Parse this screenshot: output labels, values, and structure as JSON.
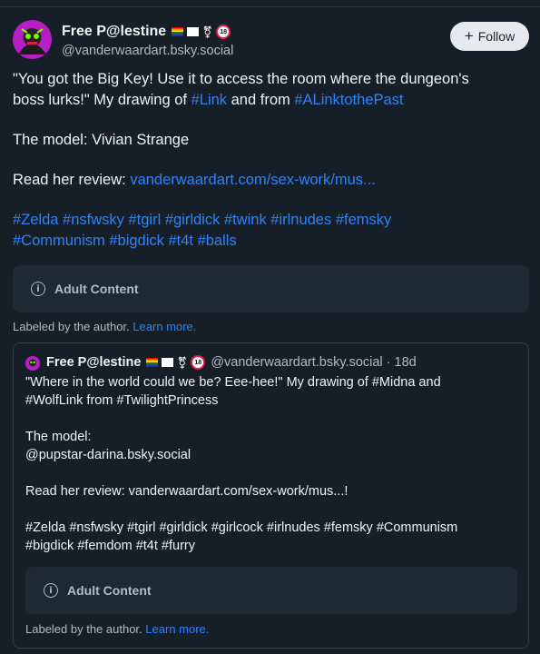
{
  "post": {
    "author_name": "Free P@lestine",
    "handle": "@vanderwaardart.bsky.social",
    "badge_text": "18",
    "follow_label": "Follow",
    "text": {
      "line1": "\"You got the Big Key! Use it to access the room where the dungeon's",
      "line2_prefix": "boss lurks!\" My drawing of ",
      "tag_link": "#Link",
      "line2_mid": " and from ",
      "tag_alttp": "#ALinktothePast",
      "model_line": "The model: Vivian Strange",
      "review_prefix": "Read her review: ",
      "review_link": "vanderwaardart.com/sex-work/mus...",
      "tags_line1": "#Zelda #nsfwsky #tgirl #girldick #twink #irlnudes #femsky",
      "tags_line2": "#Communism #bigdick #t4t #balls"
    },
    "content_warning": "Adult Content",
    "labeled_prefix": "Labeled by the author.",
    "learn_more": "Learn more."
  },
  "quote": {
    "author_name": "Free P@lestine",
    "handle": "@vanderwaardart.bsky.social · 18d",
    "line1": "\"Where in the world could we be? Eee-hee!\" My drawing of #Midna and",
    "line2": "#WolfLink from #TwilightPrincess",
    "model_label": "The model:",
    "model_handle": "@pupstar-darina.bsky.social",
    "review": "Read her review: vanderwaardart.com/sex-work/mus...!",
    "tags_line1": "#Zelda #nsfwsky #tgirl #girldick #girlcock #irlnudes #femsky #Communism",
    "tags_line2": "#bigdick #femdom #t4t #furry",
    "content_warning": "Adult Content",
    "labeled_prefix": "Labeled by the author.",
    "learn_more": "Learn more."
  },
  "colors": {
    "background": "#161e27",
    "link": "#2f83f7",
    "muted": "#aebbc9",
    "card": "#1e2936"
  },
  "icons": {
    "avatar": "purple-avatar-icon",
    "info": "info-circle-icon",
    "plus": "plus-icon"
  }
}
